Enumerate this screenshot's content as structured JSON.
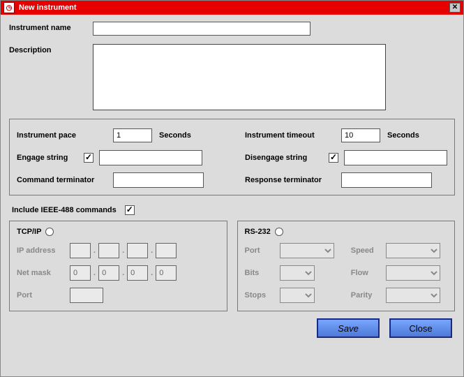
{
  "window": {
    "title": "New instrument",
    "close_glyph": "✕"
  },
  "fields": {
    "instrument_name_label": "Instrument name",
    "instrument_name_value": "",
    "description_label": "Description",
    "description_value": ""
  },
  "settings": {
    "pace_label": "Instrument pace",
    "pace_value": "1",
    "pace_unit": "Seconds",
    "timeout_label": "Instrument timeout",
    "timeout_value": "10",
    "timeout_unit": "Seconds",
    "engage_label": "Engage string",
    "engage_checked": true,
    "engage_value": "",
    "disengage_label": "Disengage string",
    "disengage_checked": true,
    "disengage_value": "",
    "cmd_term_label": "Command terminator",
    "cmd_term_value": "",
    "resp_term_label": "Response terminator",
    "resp_term_value": ""
  },
  "ieee488": {
    "label": "Include IEEE-488 commands",
    "checked": true
  },
  "tcpip": {
    "title": "TCP/IP",
    "selected": false,
    "ip_label": "IP address",
    "ip": [
      "",
      "",
      "",
      ""
    ],
    "mask_label": "Net mask",
    "mask": [
      "0",
      "0",
      "0",
      "0"
    ],
    "port_label": "Port",
    "port_value": ""
  },
  "rs232": {
    "title": "RS-232",
    "selected": false,
    "port_label": "Port",
    "bits_label": "Bits",
    "stops_label": "Stops",
    "speed_label": "Speed",
    "flow_label": "Flow",
    "parity_label": "Parity"
  },
  "buttons": {
    "save": "Save",
    "close": "Close"
  }
}
